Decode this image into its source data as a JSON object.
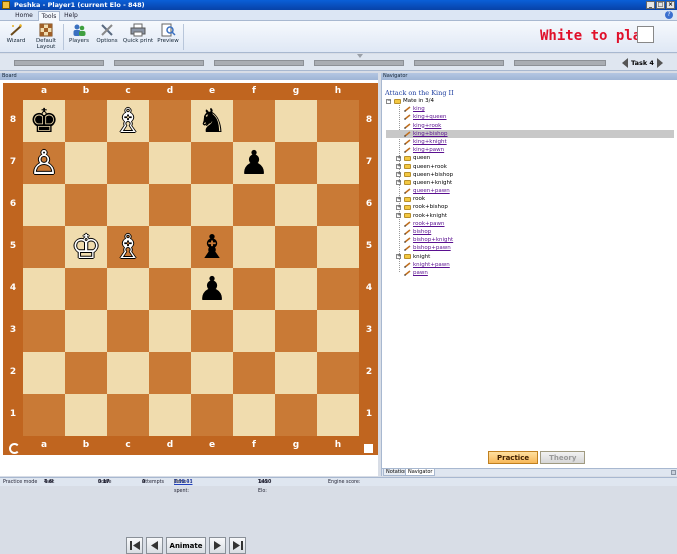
{
  "window": {
    "title": "Peshka - Player1 (current Elo - 848)",
    "controls": [
      "_",
      "□",
      "×"
    ]
  },
  "ribbon_tabs": [
    {
      "label": "Home",
      "active": false
    },
    {
      "label": "Tools",
      "active": true
    },
    {
      "label": "Help",
      "active": false
    }
  ],
  "ribbon_buttons": [
    {
      "label": "Wizard",
      "icon": "wizard-icon"
    },
    {
      "label": "Default Layout",
      "icon": "layout-icon"
    },
    {
      "label": "Players",
      "icon": "players-icon"
    },
    {
      "label": "Options",
      "icon": "options-icon"
    },
    {
      "label": "Quick print",
      "icon": "printer-icon"
    },
    {
      "label": "Preview",
      "icon": "preview-icon"
    }
  ],
  "to_move": {
    "text": "White to play",
    "color": "#e0102a"
  },
  "task_nav": {
    "label": "Task 4"
  },
  "board_panel": {
    "title": "Board"
  },
  "board": {
    "files": [
      "a",
      "b",
      "c",
      "d",
      "e",
      "f",
      "g",
      "h"
    ],
    "ranks": [
      "8",
      "7",
      "6",
      "5",
      "4",
      "3",
      "2",
      "1"
    ],
    "light_color": "#f0dcae",
    "dark_color": "#c97a36",
    "pieces": [
      {
        "square": "a8",
        "glyph": "♚",
        "color": "b"
      },
      {
        "square": "c8",
        "glyph": "♗",
        "color": "w"
      },
      {
        "square": "e8",
        "glyph": "♞",
        "color": "b"
      },
      {
        "square": "a7",
        "glyph": "♙",
        "color": "w"
      },
      {
        "square": "f7",
        "glyph": "♟",
        "color": "b"
      },
      {
        "square": "b5",
        "glyph": "♔",
        "color": "w"
      },
      {
        "square": "c5",
        "glyph": "♗",
        "color": "w"
      },
      {
        "square": "e5",
        "glyph": "♝",
        "color": "b"
      },
      {
        "square": "e4",
        "glyph": "♟",
        "color": "b"
      }
    ]
  },
  "animate_bar": {
    "animate_label": "Animate"
  },
  "navigator": {
    "panel_title": "Navigator",
    "heading": "Attack on the King II",
    "root": "Mate in 3/4",
    "items": [
      {
        "label": "king",
        "type": "leaf"
      },
      {
        "label": "king+queen",
        "type": "leaf"
      },
      {
        "label": "king+rook",
        "type": "leaf"
      },
      {
        "label": "king+bishop",
        "type": "leaf",
        "selected": true
      },
      {
        "label": "king+knight",
        "type": "leaf"
      },
      {
        "label": "king+pawn",
        "type": "leaf"
      },
      {
        "label": "queen",
        "type": "folder"
      },
      {
        "label": "queen+rook",
        "type": "folder"
      },
      {
        "label": "queen+bishop",
        "type": "folder"
      },
      {
        "label": "queen+knight",
        "type": "folder"
      },
      {
        "label": "queen+pawn",
        "type": "leaf"
      },
      {
        "label": "rook",
        "type": "folder"
      },
      {
        "label": "rook+bishop",
        "type": "folder"
      },
      {
        "label": "rook+knight",
        "type": "folder"
      },
      {
        "label": "rook+pawn",
        "type": "leaf"
      },
      {
        "label": "bishop",
        "type": "leaf"
      },
      {
        "label": "bishop+knight",
        "type": "leaf"
      },
      {
        "label": "bishop+pawn",
        "type": "leaf"
      },
      {
        "label": "knight",
        "type": "folder"
      },
      {
        "label": "knight+pawn",
        "type": "leaf"
      },
      {
        "label": "pawn",
        "type": "leaf"
      }
    ],
    "mode_buttons": [
      {
        "label": "Practice",
        "active": true
      },
      {
        "label": "Theory",
        "active": false
      }
    ],
    "bottom_tabs": [
      {
        "label": "Notation",
        "active": false
      },
      {
        "label": "Navigator",
        "active": true
      }
    ]
  },
  "status": {
    "mode": "Practice mode",
    "task_prefix": "Task",
    "task_num": "4",
    "task_of": "of",
    "task_total": "6",
    "score_prefix": "Score",
    "score_val": "0",
    "score_of": "of",
    "score_total": "17",
    "attempts_label": "Attempts",
    "attempts_val": "0",
    "time_label": "Time spent:",
    "time_val": "0:00:01",
    "time_sep": "/",
    "time_total": "1:18:43",
    "elo_label": "Task Elo:",
    "elo_val": "1450",
    "engine_label": "Engine score:"
  }
}
